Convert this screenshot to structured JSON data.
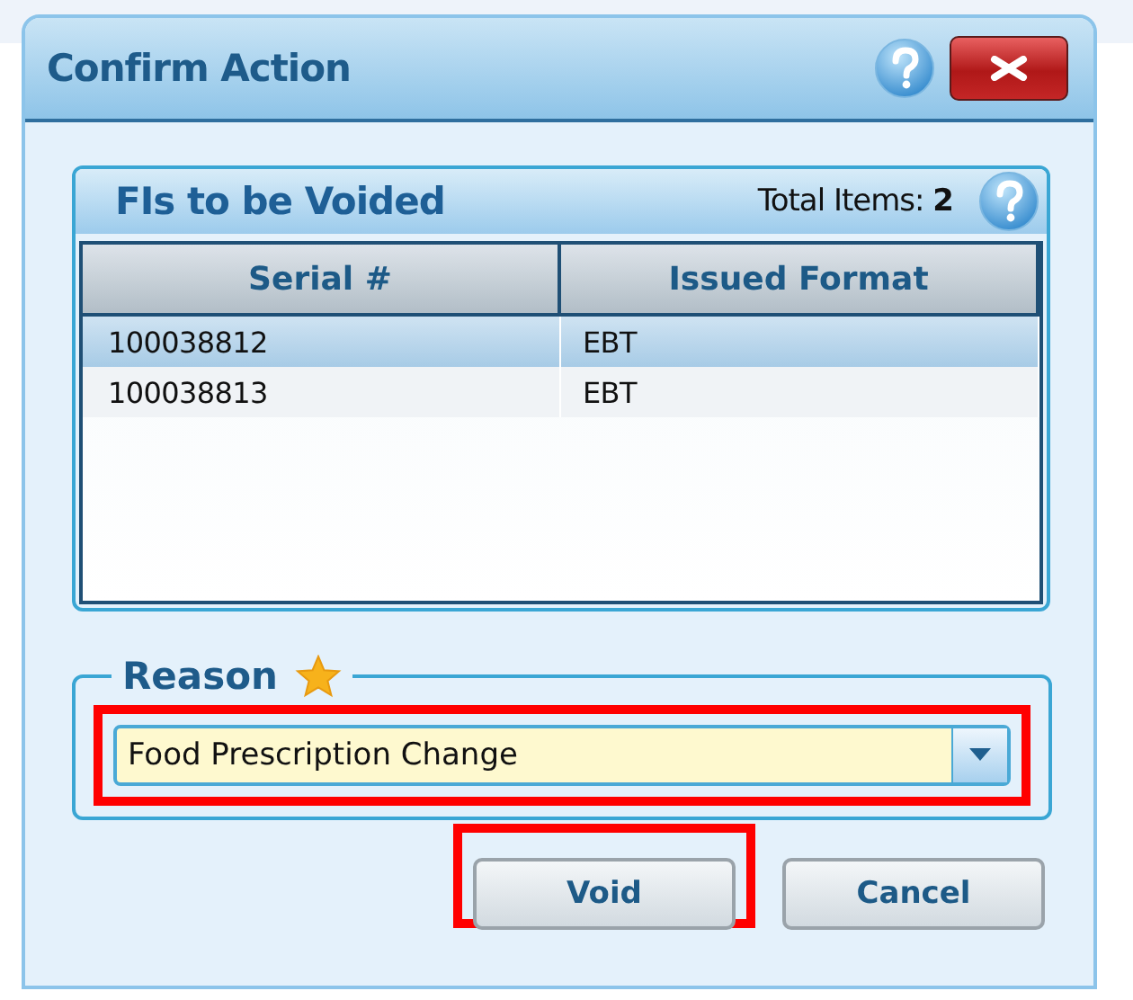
{
  "window": {
    "title": "Confirm Action"
  },
  "panel": {
    "title": "FIs to be Voided",
    "total": "Total Items: **2**"
  },
  "table": {
    "columns": [
      "Serial #",
      "Issued Format"
    ],
    "rows": [
      {
        "cells": [
          "100038812",
          "EBT"
        ],
        "selected": true
      },
      {
        "cells": [
          "100038813",
          "EBT"
        ],
        "selected": false
      }
    ]
  },
  "reason": {
    "label": "Reason",
    "required": true,
    "value": "Food Prescription Change",
    "highlighted": true
  },
  "buttons": [
    {
      "label": "Void",
      "highlighted": true
    },
    {
      "label": "Cancel",
      "highlighted": false
    }
  ]
}
